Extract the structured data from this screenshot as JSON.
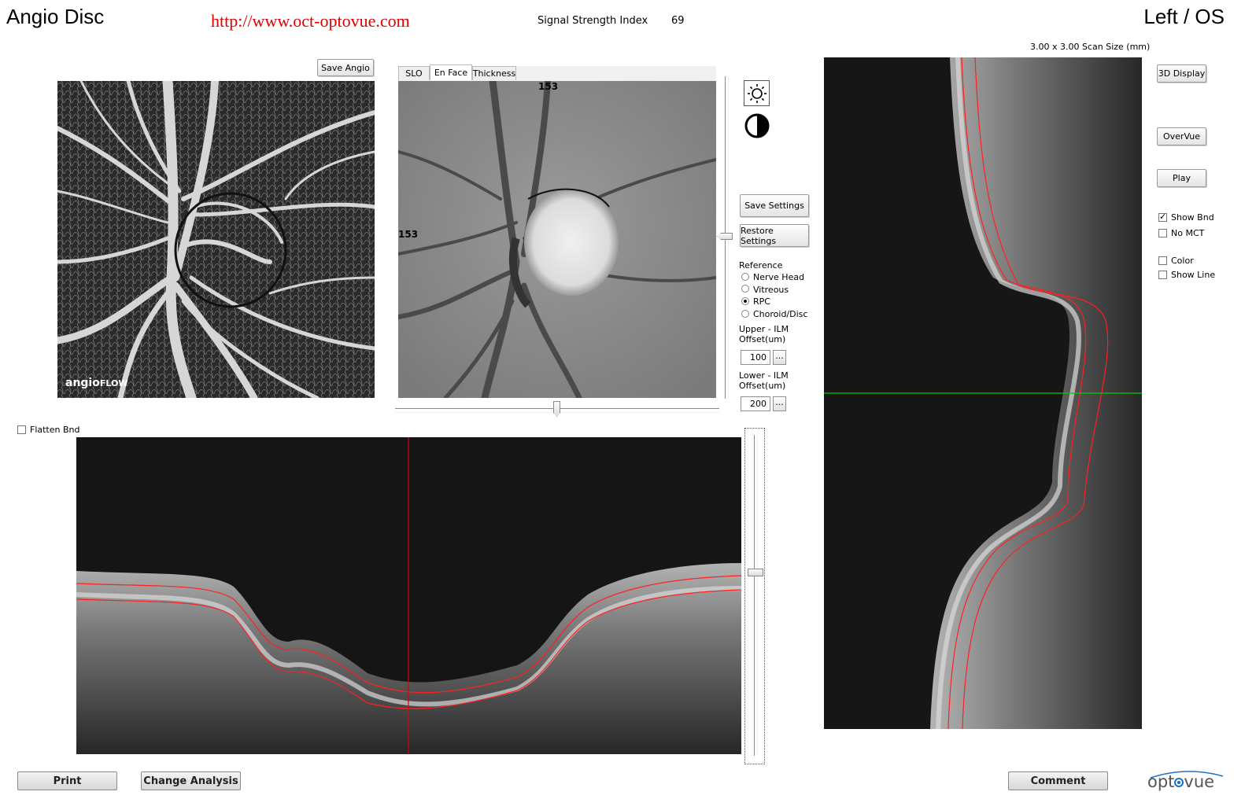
{
  "header": {
    "title": "Angio Disc",
    "url": "http://www.oct-optovue.com",
    "ssi_label": "Signal Strength Index",
    "ssi_value": "69",
    "eye": "Left / OS",
    "scan_size": "3.00 x 3.00 Scan Size (mm)"
  },
  "angio_panel": {
    "save_label": "Save Angio",
    "brand_a": "angio",
    "brand_b": "FLOW"
  },
  "enface_panel": {
    "tabs": [
      {
        "label": "SLO",
        "active": false
      },
      {
        "label": "En Face",
        "active": true
      },
      {
        "label": "Thickness",
        "active": false
      }
    ],
    "top_marker": "153",
    "left_marker": "153"
  },
  "display_controls": {
    "brightness_icon": "sun-icon",
    "contrast_icon": "contrast-icon",
    "save_settings": "Save Settings",
    "restore_settings": "Restore Settings",
    "reference_label": "Reference",
    "reference_options": [
      {
        "label": "Nerve Head",
        "selected": false
      },
      {
        "label": "Vitreous",
        "selected": false
      },
      {
        "label": "RPC",
        "selected": true
      },
      {
        "label": "Choroid/Disc",
        "selected": false
      }
    ],
    "upper_label_1": "Upper - ILM",
    "upper_label_2": "Offset(um)",
    "upper_value": "100",
    "lower_label_1": "Lower - ILM",
    "lower_label_2": "Offset(um)",
    "lower_value": "200",
    "ellipsis": "..."
  },
  "right_controls": {
    "display_3d": "3D Display",
    "overvue": "OverVue",
    "play": "Play",
    "checkboxes": [
      {
        "label": "Show Bnd",
        "checked": true
      },
      {
        "label": "No MCT",
        "checked": false
      },
      {
        "label": "Color",
        "checked": false
      },
      {
        "label": "Show Line",
        "checked": false
      }
    ]
  },
  "bscan": {
    "flatten_label": "Flatten Bnd",
    "flatten_checked": false
  },
  "footer": {
    "print": "Print",
    "change_analysis": "Change Analysis",
    "comment": "Comment",
    "logo_left": "opt",
    "logo_right": "vue"
  },
  "colors": {
    "url_red": "#e00000",
    "boundary_red": "#ff2020",
    "scan_line_green": "#00d000",
    "logo_blue": "#1a73c8"
  }
}
